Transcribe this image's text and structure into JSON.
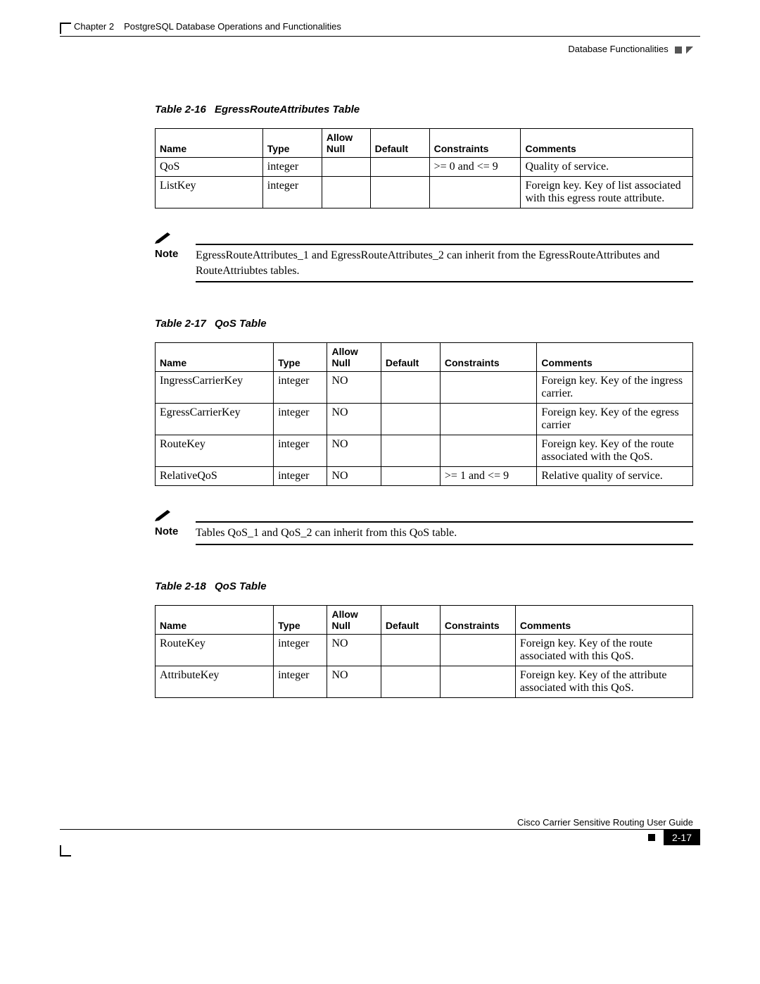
{
  "header": {
    "chapter": "Chapter 2",
    "chapter_title": "PostgreSQL Database Operations and Functionalities",
    "section": "Database Functionalities"
  },
  "tables": [
    {
      "caption_num": "Table 2-16",
      "caption_title": "EgressRouteAttributes Table",
      "columns": [
        "Name",
        "Type",
        "Allow Null",
        "Default",
        "Constraints",
        "Comments"
      ],
      "rows": [
        {
          "c0": "QoS",
          "c1": "integer",
          "c2": "",
          "c3": "",
          "c4": ">= 0 and <= 9",
          "c5": "Quality of service."
        },
        {
          "c0": "ListKey",
          "c1": "integer",
          "c2": "",
          "c3": "",
          "c4": "",
          "c5": "Foreign key. Key of list associated with this egress route attribute."
        }
      ],
      "widths": [
        20,
        11,
        9,
        11,
        17,
        32
      ]
    },
    {
      "caption_num": "Table 2-17",
      "caption_title": "QoS Table",
      "columns": [
        "Name",
        "Type",
        "Allow Null",
        "Default",
        "Constraints",
        "Comments"
      ],
      "rows": [
        {
          "c0": "IngressCarrierKey",
          "c1": "integer",
          "c2": "NO",
          "c3": "",
          "c4": "",
          "c5": "Foreign key. Key of the ingress carrier."
        },
        {
          "c0": "EgressCarrierKey",
          "c1": "integer",
          "c2": "NO",
          "c3": "",
          "c4": "",
          "c5": "Foreign key. Key of the egress carrier"
        },
        {
          "c0": "RouteKey",
          "c1": "integer",
          "c2": "NO",
          "c3": "",
          "c4": "",
          "c5": "Foreign key. Key of the route associated with the QoS."
        },
        {
          "c0": "RelativeQoS",
          "c1": "integer",
          "c2": "NO",
          "c3": "",
          "c4": ">= 1 and <= 9",
          "c5": "Relative quality of service."
        }
      ],
      "widths": [
        22,
        10,
        10,
        11,
        18,
        29
      ]
    },
    {
      "caption_num": "Table 2-18",
      "caption_title": "QoS Table",
      "columns": [
        "Name",
        "Type",
        "Allow Null",
        "Default",
        "Constraints",
        "Comments"
      ],
      "rows": [
        {
          "c0": "RouteKey",
          "c1": "integer",
          "c2": "NO",
          "c3": "",
          "c4": "",
          "c5": "Foreign key. Key of the route associated with this QoS."
        },
        {
          "c0": "AttributeKey",
          "c1": "integer",
          "c2": "NO",
          "c3": "",
          "c4": "",
          "c5": "Foreign key. Key of the attribute associated with this QoS."
        }
      ],
      "widths": [
        22,
        10,
        10,
        11,
        14,
        33
      ]
    }
  ],
  "notes": [
    {
      "label": "Note",
      "text": "EgressRouteAttributes_1 and EgressRouteAttributes_2 can inherit from the EgressRouteAttributes and RouteAttriubtes tables."
    },
    {
      "label": "Note",
      "text": "Tables QoS_1 and QoS_2 can inherit from this QoS table."
    }
  ],
  "footer": {
    "guide": "Cisco Carrier Sensitive Routing User Guide",
    "pagenum": "2-17"
  }
}
